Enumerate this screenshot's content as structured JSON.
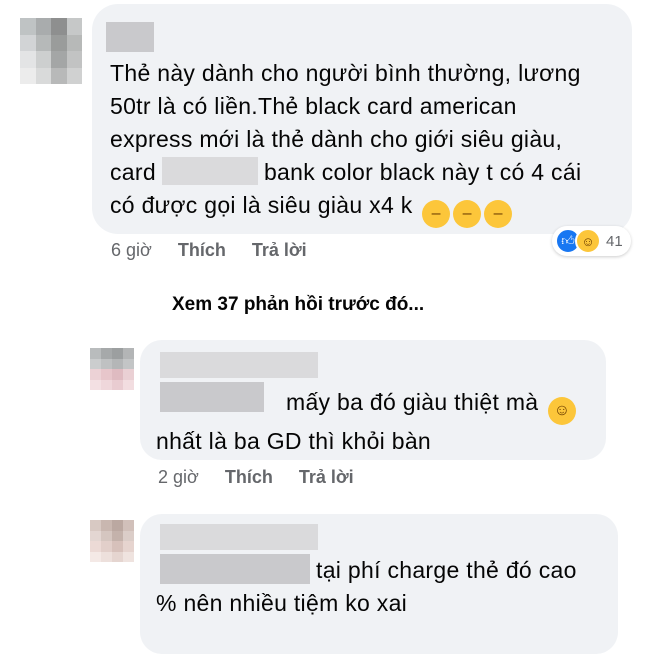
{
  "comment1": {
    "lines": [
      "Thẻ này dành cho người bình thường, lương",
      "50tr là có liền.Thẻ black card american",
      "express mới là thẻ dành cho giới siêu giàu,",
      "card",
      "bank color black này t có 4 cái",
      "có được gọi là siêu giàu x4 k"
    ],
    "time": "6 giờ",
    "like": "Thích",
    "reply": "Trả lời",
    "reaction_count": "41"
  },
  "view_more": "Xem 37 phản hồi trước đó...",
  "comment2": {
    "line1": "mấy ba đó giàu thiệt mà",
    "line2": "nhất là ba GD thì khỏi bàn",
    "time": "2 giờ",
    "like": "Thích",
    "reply": "Trả lời"
  },
  "comment3": {
    "line1": "tại phí charge thẻ đó cao",
    "line2": "% nên nhiều tiệm ko xai"
  },
  "colors": {
    "bubble": "#f0f2f5",
    "meta_text": "#65676b",
    "like_blue": "#1877f2",
    "haha_yellow": "#fcc63a"
  },
  "icons": {
    "reaction_like": "thumbs-up-icon",
    "reaction_haha": "laughing-icon",
    "emoji_smirk": "smirking-face-icon",
    "emoji_rofl": "rolling-laughing-icon"
  }
}
